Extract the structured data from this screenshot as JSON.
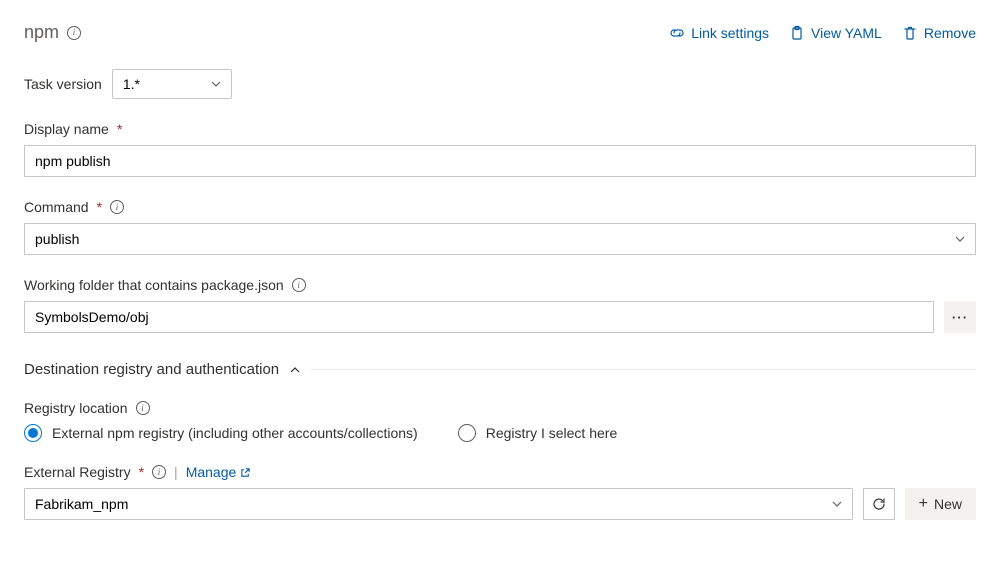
{
  "header": {
    "title": "npm",
    "actions": {
      "link_settings": "Link settings",
      "view_yaml": "View YAML",
      "remove": "Remove"
    }
  },
  "task_version": {
    "label": "Task version",
    "value": "1.*"
  },
  "display_name": {
    "label": "Display name",
    "value": "npm publish"
  },
  "command": {
    "label": "Command",
    "value": "publish"
  },
  "working_folder": {
    "label": "Working folder that contains package.json",
    "value": "SymbolsDemo/obj"
  },
  "section": {
    "title": "Destination registry and authentication"
  },
  "registry_location": {
    "label": "Registry location",
    "options": {
      "external": "External npm registry (including other accounts/collections)",
      "select_here": "Registry I select here"
    },
    "selected": "external"
  },
  "external_registry": {
    "label": "External Registry",
    "manage": "Manage",
    "value": "Fabrikam_npm",
    "new_btn": "New"
  }
}
